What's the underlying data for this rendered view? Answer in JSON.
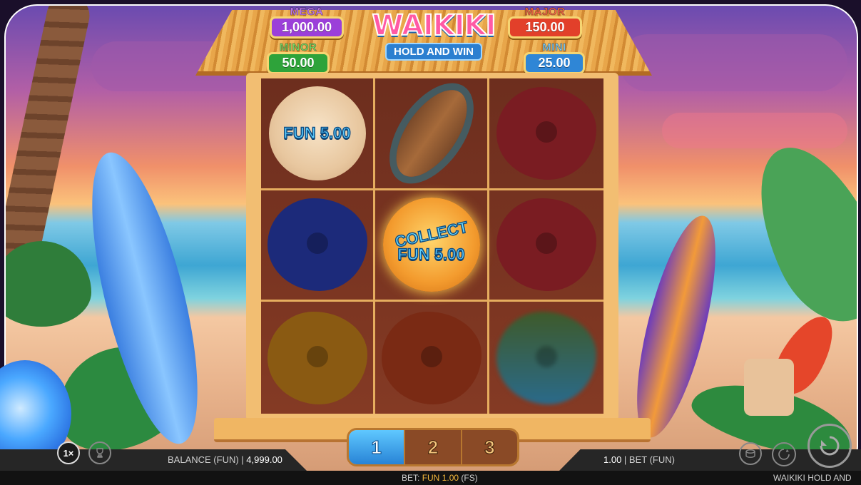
{
  "jackpots": {
    "mega": {
      "label": "MEGA",
      "value": "1,000.00",
      "color": "#9b3fd9"
    },
    "major": {
      "label": "MAJOR",
      "value": "150.00",
      "color": "#e2402a"
    },
    "minor": {
      "label": "MINOR",
      "value": "50.00",
      "color": "#2ea33a"
    },
    "mini": {
      "label": "MINI",
      "value": "25.00",
      "color": "#2f86d6"
    }
  },
  "logo": {
    "title": "WAIKIKI",
    "subtitle": "HOLD AND WIN"
  },
  "grid": [
    {
      "symbol": "sand-dollar-coin",
      "text": "FUN 5.00"
    },
    {
      "symbol": "surfboard-wave",
      "text": ""
    },
    {
      "symbol": "hibiscus",
      "color": "#7a1c22"
    },
    {
      "symbol": "hibiscus",
      "color": "#1c2a7a"
    },
    {
      "symbol": "collect-coin",
      "label": "COLLECT",
      "text": "FUN 5.00"
    },
    {
      "symbol": "hibiscus",
      "color": "#7a1c22"
    },
    {
      "symbol": "hibiscus",
      "color": "#8a5a12"
    },
    {
      "symbol": "hibiscus",
      "color": "#7a2a14"
    },
    {
      "symbol": "blurred",
      "color": "#5a7a3a"
    }
  ],
  "reel_tabs": [
    {
      "label": "1",
      "active": true
    },
    {
      "label": "2",
      "active": false
    },
    {
      "label": "3",
      "active": false
    }
  ],
  "status_bar": {
    "speed": "1×",
    "balance_label": "BALANCE (FUN)",
    "balance_value": "4,999.00",
    "bet_value": "1.00",
    "bet_label": "BET (FUN)",
    "bottom_bet_label": "BET:",
    "bottom_bet_value": "FUN 1.00",
    "bottom_bet_mode": "(FS)",
    "game_name": "WAIKIKI HOLD AND"
  },
  "colors": {
    "accent_gold": "#f4c57c",
    "tab_active": "#2883d6",
    "bar_bg": "#262626"
  }
}
